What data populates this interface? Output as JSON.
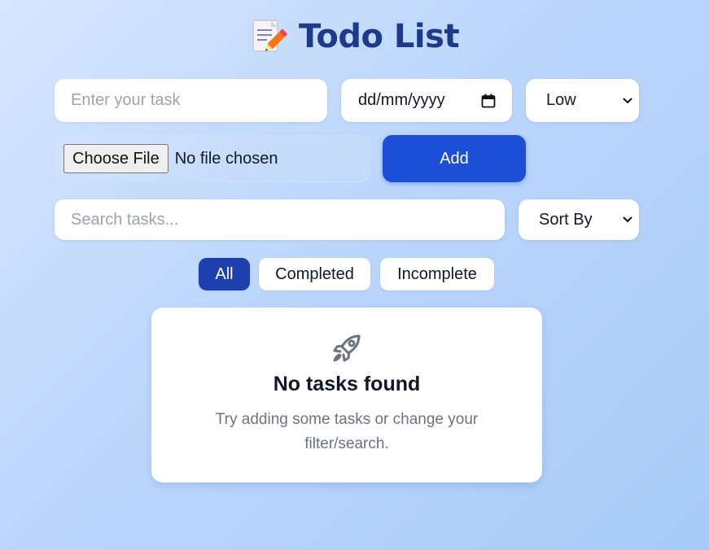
{
  "header": {
    "icon": "memo-icon",
    "title": "Todo List"
  },
  "form": {
    "task_placeholder": "Enter your task",
    "date_placeholder": "dd/mm/yyyy",
    "date_icon": "calendar-icon",
    "priority_selected": "Low",
    "file_button_label": "Choose File",
    "file_status": "No file chosen",
    "add_label": "Add"
  },
  "toolbar": {
    "search_placeholder": "Search tasks...",
    "sort_selected": "Sort By"
  },
  "filters": [
    {
      "label": "All",
      "active": true
    },
    {
      "label": "Completed",
      "active": false
    },
    {
      "label": "Incomplete",
      "active": false
    }
  ],
  "empty_state": {
    "icon": "rocket-icon",
    "title": "No tasks found",
    "message": "Try adding some tasks or change your filter/search."
  },
  "colors": {
    "accent": "#1d4ed8",
    "active_filter": "#1e40af",
    "title": "#1e3a8a"
  }
}
